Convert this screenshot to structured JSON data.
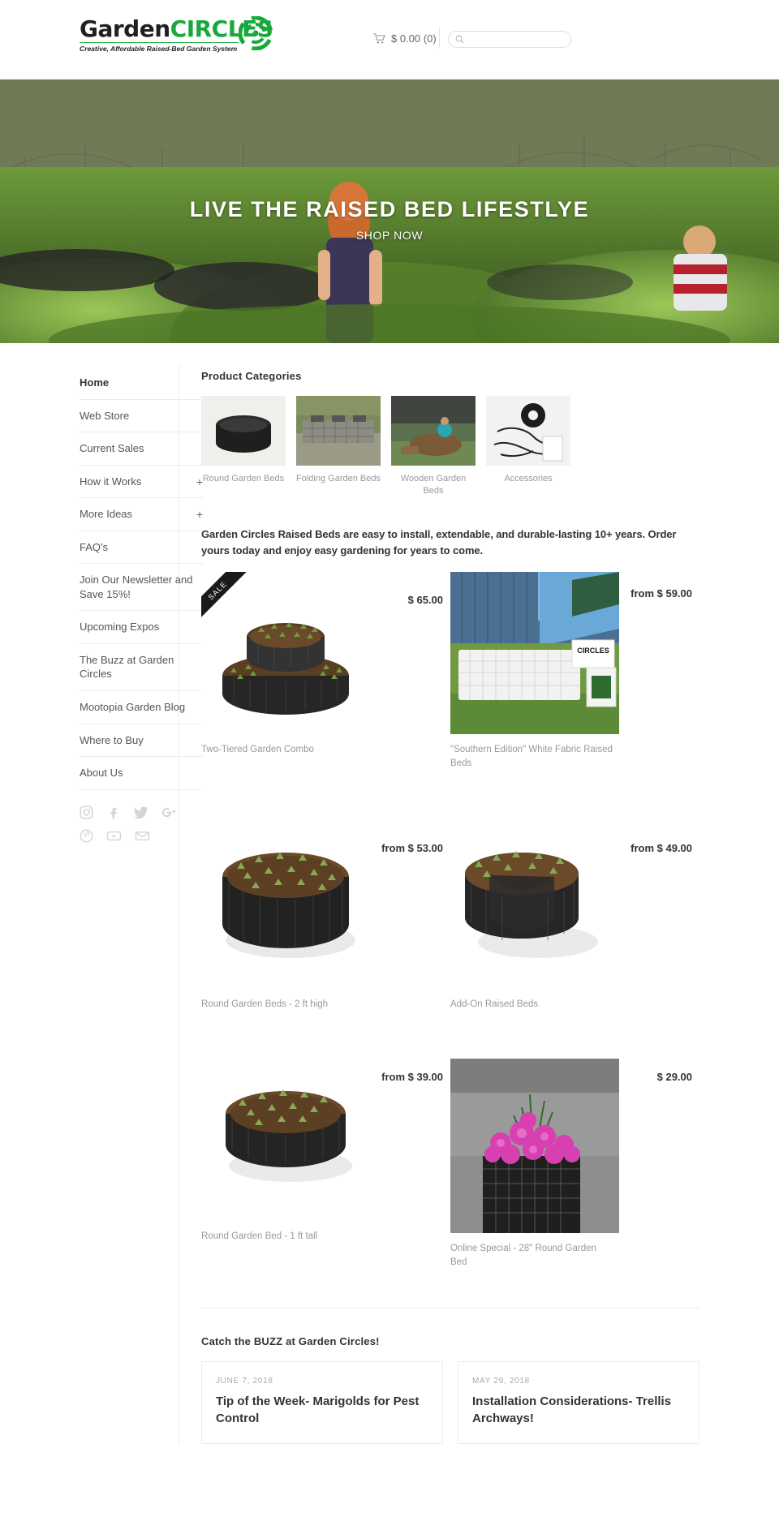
{
  "header": {
    "logo_main_left": "Garden",
    "logo_main_right": "CIRCLES",
    "logo_tagline": "Creative, Affordable Raised-Bed Garden System",
    "cart_label": "$ 0.00 (0)",
    "search_placeholder": "",
    "search_value": ""
  },
  "hero": {
    "title": "LIVE THE RAISED BED LIFESTLYE",
    "cta": "SHOP NOW"
  },
  "sidebar": {
    "items": [
      {
        "label": "Home",
        "expand": ""
      },
      {
        "label": "Web Store",
        "expand": ""
      },
      {
        "label": "Current Sales",
        "expand": ""
      },
      {
        "label": "How it Works",
        "expand": "+"
      },
      {
        "label": "More Ideas",
        "expand": "+"
      },
      {
        "label": "FAQ's",
        "expand": ""
      },
      {
        "label": "Join Our Newsletter and Save 15%!",
        "expand": ""
      },
      {
        "label": "Upcoming Expos",
        "expand": ""
      },
      {
        "label": "The Buzz at Garden Circles",
        "expand": ""
      },
      {
        "label": "Mootopia Garden Blog",
        "expand": ""
      },
      {
        "label": "Where to Buy",
        "expand": ""
      },
      {
        "label": "About Us",
        "expand": ""
      }
    ],
    "social": [
      "instagram-icon",
      "facebook-icon",
      "twitter-icon",
      "google-plus-icon",
      "pinterest-icon",
      "youtube-icon",
      "email-icon"
    ]
  },
  "main": {
    "categories_title": "Product Categories",
    "categories": [
      {
        "label": "Round Garden Beds"
      },
      {
        "label": "Folding Garden Beds"
      },
      {
        "label": "Wooden Garden Beds"
      },
      {
        "label": "Accessories"
      }
    ],
    "intro": "Garden Circles Raised Beds are easy to install, extendable, and durable-lasting 10+ years. Order yours today and enjoy easy gardening for years to come.",
    "products": [
      {
        "title": "Two-Tiered Garden Combo",
        "price": "$ 65.00",
        "badge": "SALE"
      },
      {
        "title": "\"Southern Edition\" White Fabric Raised Beds",
        "price": "from $ 59.00",
        "badge": ""
      },
      {
        "title": "Round Garden Beds - 2 ft high",
        "price": "from $ 53.00",
        "badge": ""
      },
      {
        "title": "Add-On Raised Beds",
        "price": "from $ 49.00",
        "badge": ""
      },
      {
        "title": "Round Garden Bed - 1 ft tall",
        "price": "from $ 39.00",
        "badge": ""
      },
      {
        "title": "Online Special - 28\" Round Garden Bed",
        "price": "$ 29.00",
        "badge": ""
      }
    ],
    "blog_title": "Catch the BUZZ at Garden Circles!",
    "blog_posts": [
      {
        "date": "JUNE 7, 2018",
        "title": "Tip of the Week- Marigolds for Pest Control"
      },
      {
        "date": "MAY 29, 2018",
        "title": "Installation Considerations- Trellis Archways!"
      }
    ]
  },
  "colors": {
    "brand_green": "#18a93c",
    "text_dark": "#333333",
    "text_muted": "#999999"
  }
}
